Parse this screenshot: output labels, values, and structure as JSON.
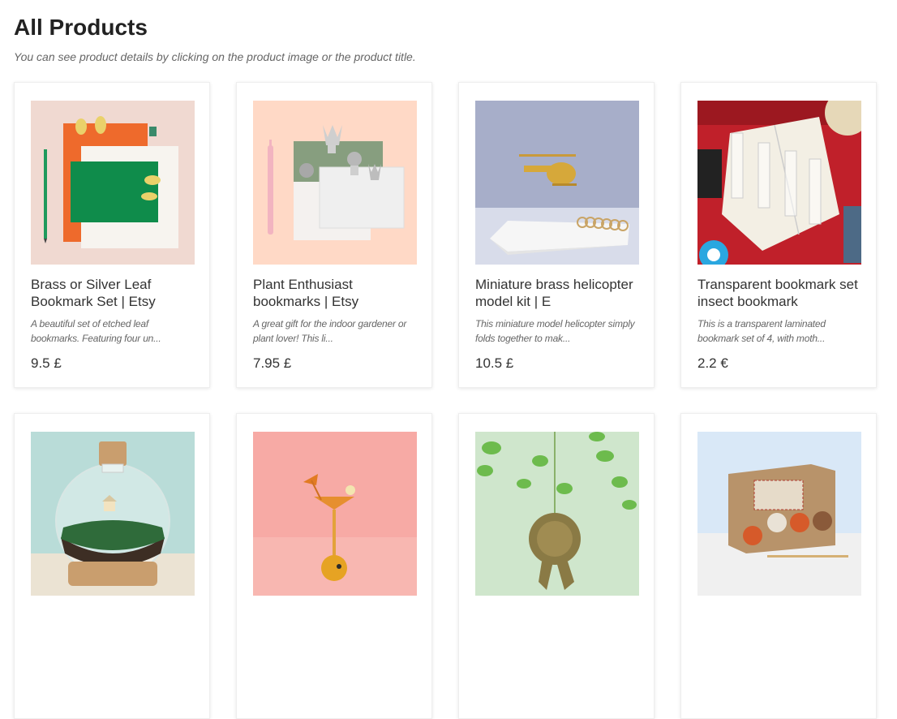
{
  "page": {
    "title": "All Products",
    "subtitle": "You can see product details by clicking on the product image or the product title."
  },
  "products": [
    {
      "name": "Brass or Silver Leaf Bookmark Set | Etsy",
      "description": "A beautiful set of etched leaf bookmarks. Featuring four un...",
      "price": "9.5 £",
      "image": "leaf-bookmark-set"
    },
    {
      "name": "Plant Enthusiast bookmarks | Etsy",
      "description": "A great gift for the indoor gardener or plant lover! This li...",
      "price": "7.95 £",
      "image": "plant-bookmarks"
    },
    {
      "name": "Miniature brass helicopter model kit | E",
      "description": "This miniature model helicopter simply folds together to mak...",
      "price": "10.5 £",
      "image": "brass-helicopter"
    },
    {
      "name": "Transparent bookmark set insect bookmark",
      "description": "This is a transparent laminated bookmark set of 4, with moth...",
      "price": "2.2 €",
      "image": "insect-bookmarks"
    },
    {
      "name": "",
      "description": "",
      "price": "",
      "image": "terrarium"
    },
    {
      "name": "",
      "description": "",
      "price": "",
      "image": "cocktail-ornament"
    },
    {
      "name": "",
      "description": "",
      "price": "",
      "image": "rosette-ornament"
    },
    {
      "name": "",
      "description": "",
      "price": "",
      "image": "crochet-kit"
    }
  ]
}
